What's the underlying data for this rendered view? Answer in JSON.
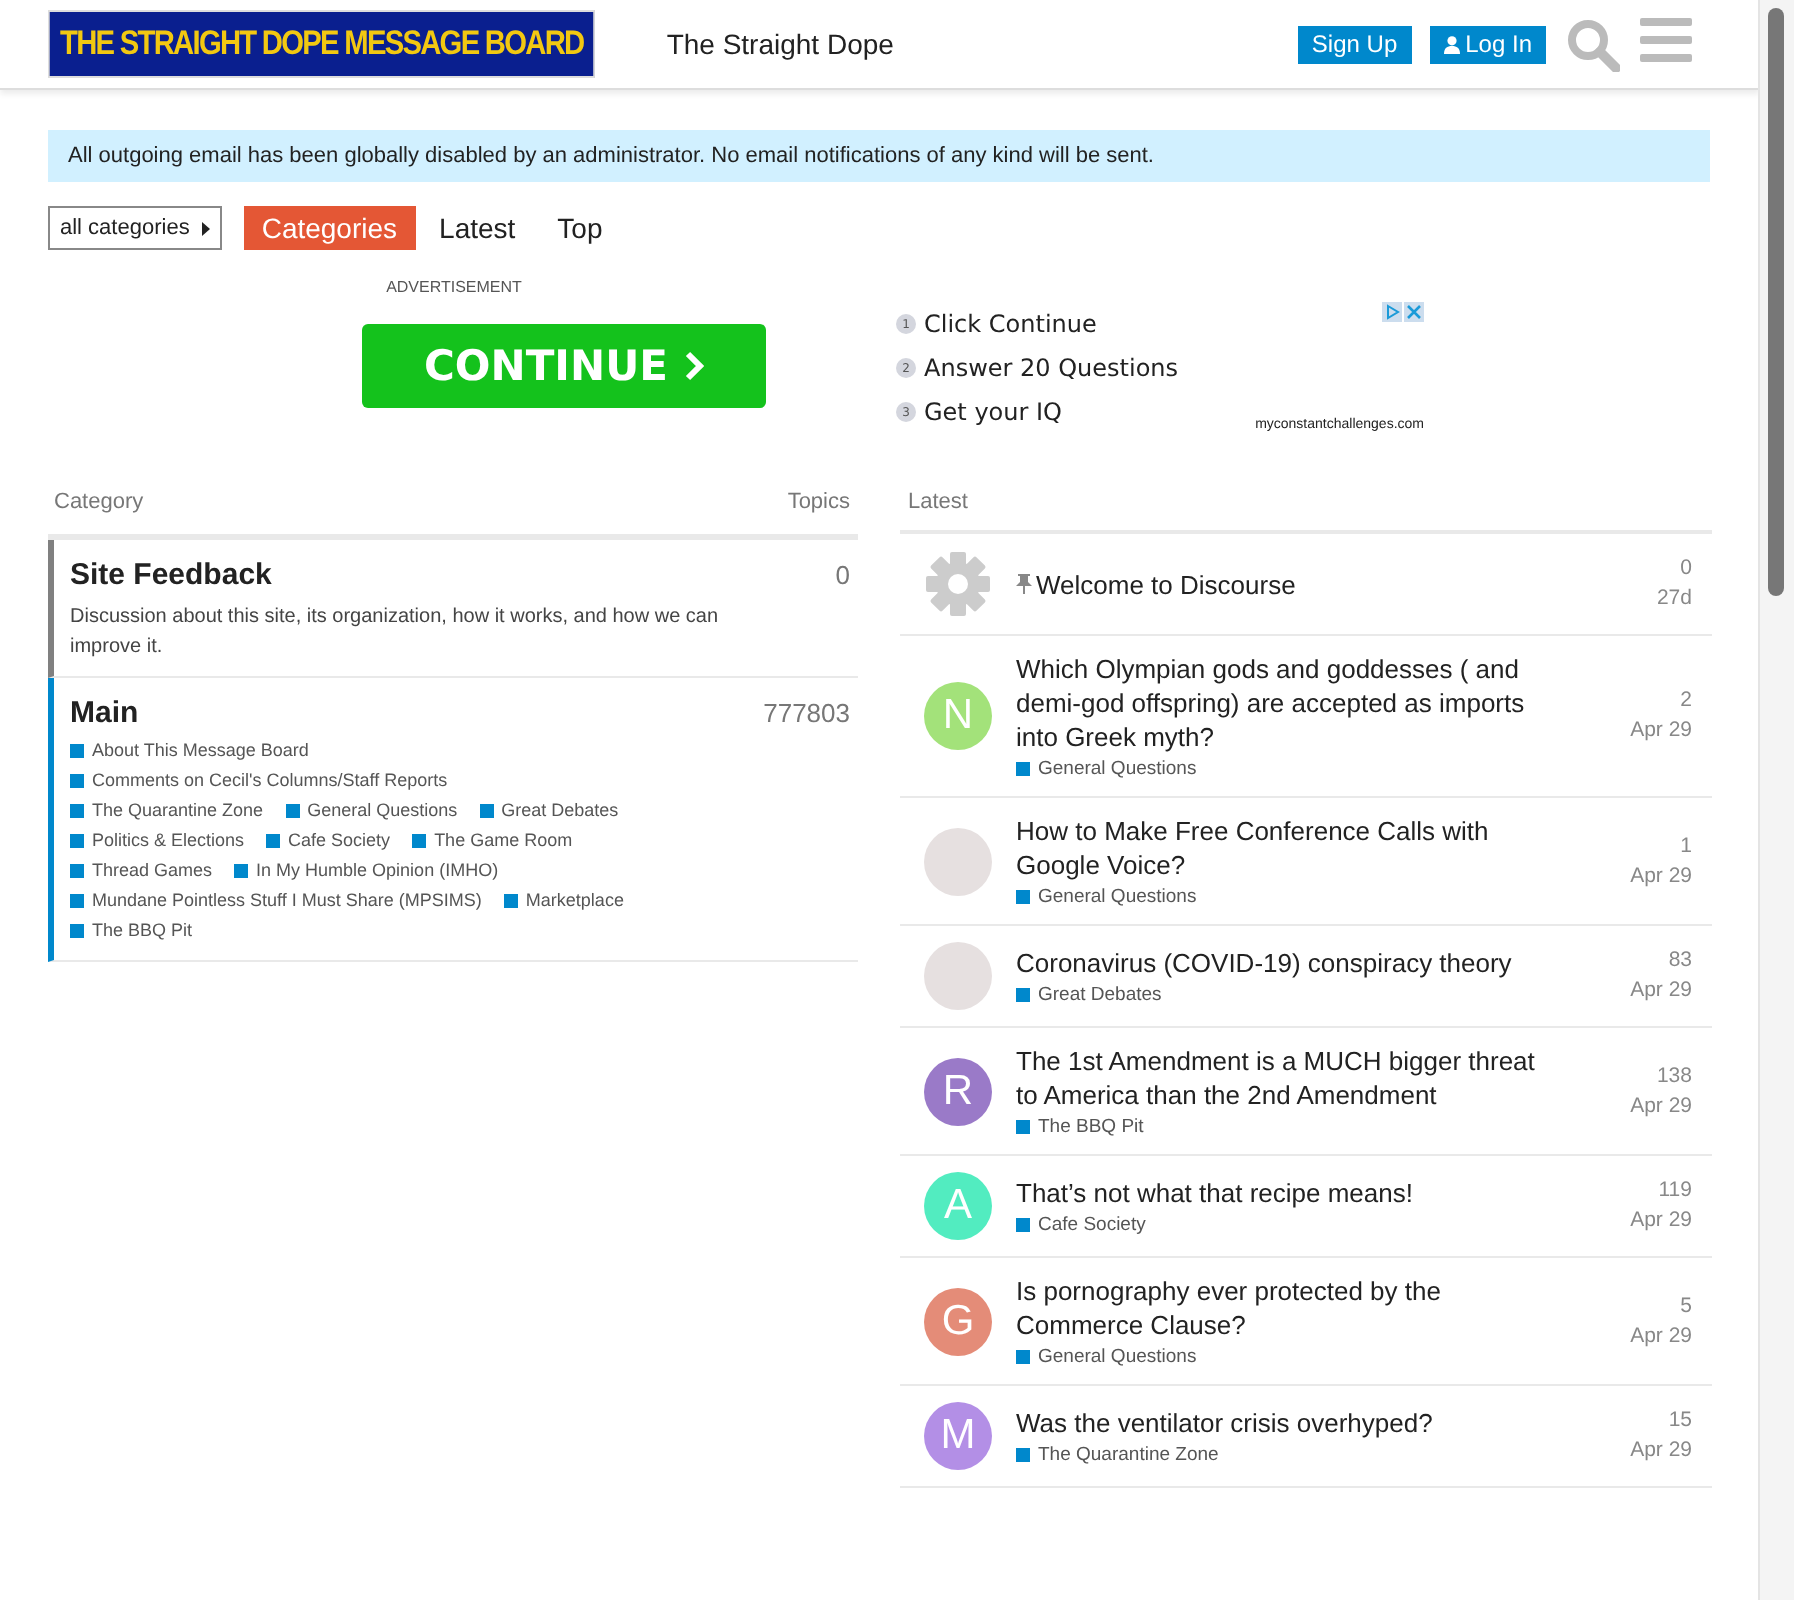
{
  "header": {
    "logo": "THE STRAIGHT DOPE MESSAGE BOARD",
    "site_title": "The Straight Dope",
    "buttons": [
      {
        "label": "Sign Up",
        "kind": "plain"
      },
      {
        "label": "Log In",
        "kind": "user"
      }
    ]
  },
  "notice": "All outgoing email has been globally disabled by an administrator. No email notifications of any kind will be sent.",
  "nav": {
    "dropdown": "all categories",
    "tabs": [
      {
        "label": "Categories",
        "selected": true
      },
      {
        "label": "Latest",
        "selected": false
      },
      {
        "label": "Top",
        "selected": false
      }
    ]
  },
  "ad": {
    "label": "ADVERTISEMENT",
    "button": "CONTINUE",
    "steps": [
      {
        "number": "1",
        "text": "Click Continue"
      },
      {
        "number": "2",
        "text": "Answer 20 Questions"
      },
      {
        "number": "3",
        "text": "Get your IQ"
      }
    ],
    "domain": "myconstantchallenges.com"
  },
  "categories": {
    "columns": [
      "Category",
      "Topics"
    ],
    "rows": [
      {
        "name": "Site Feedback",
        "color": "#808080",
        "topics": "0",
        "description": "Discussion about this site, its organization, how it works, and how we can improve it.",
        "subcategories": []
      },
      {
        "name": "Main",
        "color": "#0088cc",
        "topics": "777803",
        "subcategories": [
          "About This Message Board",
          "Comments on Cecil's Columns/Staff Reports",
          "The Quarantine Zone",
          "General Questions",
          "Great Debates",
          "Politics & Elections",
          "Cafe Society",
          "The Game Room",
          "Thread Games",
          "In My Humble Opinion (IMHO)",
          "Mundane Pointless Stuff I Must Share (MPSIMS)",
          "Marketplace",
          "The BBQ Pit"
        ]
      }
    ]
  },
  "latest": {
    "column": "Latest",
    "topics": [
      {
        "kind": "gear",
        "pinned": true,
        "title": "Welcome to Discourse",
        "replies": "0",
        "age": "27d"
      },
      {
        "kind": "letter",
        "letter": "N",
        "color": "#a3e27a",
        "pinned": false,
        "title": "Which Olympian gods and goddesses ( and demi-god offspring) are accepted as imports into Greek myth?",
        "category": "General Questions",
        "replies": "2",
        "age": "Apr 29"
      },
      {
        "kind": "photo",
        "pinned": false,
        "title": "How to Make Free Conference Calls with Google Voice?",
        "category": "General Questions",
        "replies": "1",
        "age": "Apr 29"
      },
      {
        "kind": "photo",
        "pinned": false,
        "title": "Coronavirus (COVID-19) conspiracy theory",
        "category": "Great Debates",
        "replies": "83",
        "age": "Apr 29"
      },
      {
        "kind": "letter",
        "letter": "R",
        "color": "#9a7ac8",
        "pinned": false,
        "title": "The 1st Amendment is a MUCH bigger threat to America than the 2nd Amendment",
        "category": "The BBQ Pit",
        "replies": "138",
        "age": "Apr 29"
      },
      {
        "kind": "letter",
        "letter": "A",
        "color": "#52ecc0",
        "pinned": false,
        "title": "That’s not what that recipe means!",
        "category": "Cafe Society",
        "replies": "119",
        "age": "Apr 29"
      },
      {
        "kind": "letter",
        "letter": "G",
        "color": "#e48c78",
        "pinned": false,
        "title": "Is pornography ever protected by the Commerce Clause?",
        "category": "General Questions",
        "replies": "5",
        "age": "Apr 29"
      },
      {
        "kind": "letter",
        "letter": "M",
        "color": "#b38fe6",
        "pinned": false,
        "title": "Was the ventilator crisis overhyped?",
        "category": "The Quarantine Zone",
        "replies": "15",
        "age": "Apr 29"
      }
    ]
  }
}
